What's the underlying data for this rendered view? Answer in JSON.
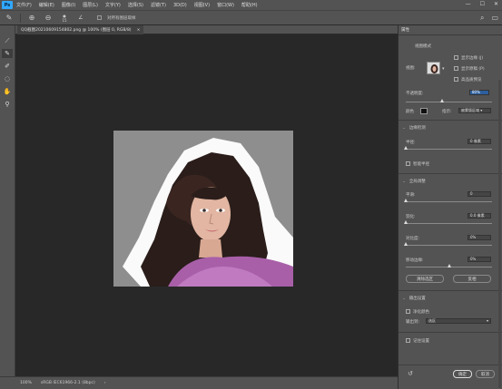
{
  "menubar": {
    "logo": "Ps",
    "items": [
      "文件(F)",
      "编辑(E)",
      "图像(I)",
      "图层(L)",
      "文字(Y)",
      "选择(S)",
      "滤镜(T)",
      "3D(D)",
      "视图(V)",
      "窗口(W)",
      "帮助(H)"
    ],
    "min": "—",
    "max": "☐",
    "close": "✕"
  },
  "options": {
    "brush_size": "15",
    "align_label": "对所有图层取样",
    "search_icon": "⌕",
    "share_icon": "▭"
  },
  "doc": {
    "tab_title": "QQ截图20210609154802.png @ 100% (图层 0, RGB/8)",
    "tab_close": "×"
  },
  "status": {
    "zoom": "100%",
    "info": "sRGB IEC61966-2.1 (8bpc)",
    "arrow": "›"
  },
  "panel": {
    "title": "属性",
    "view_mode": {
      "section": "视图模式",
      "view_label": "视图:",
      "show_edges": "显示边缘 (J)",
      "show_original": "显示原稿 (P)",
      "hq_preview": "高品质预览"
    },
    "opacity_label": "不透明度:",
    "opacity_value": "80%",
    "color_label": "颜色",
    "indicate_label": "指示:",
    "indicate_value": "被蒙版区域",
    "edge_detection": {
      "section": "边缘检测",
      "radius_label": "半径:",
      "radius_value": "0 像素",
      "smart_radius": "智能半径"
    },
    "global": {
      "section": "全局调整",
      "smooth_label": "平滑:",
      "smooth_value": "0",
      "feather_label": "羽化:",
      "feather_value": "0.0 像素",
      "contrast_label": "对比度:",
      "contrast_value": "0%",
      "shift_label": "移动边缘:",
      "shift_value": "0%",
      "clear_selection": "清除选区",
      "invert": "反相"
    },
    "output": {
      "section": "输出设置",
      "decontaminate": "净化颜色",
      "output_to_label": "输出到:",
      "output_to_value": "选区",
      "remember": "记住设置"
    },
    "ok": "确定",
    "cancel": "取消",
    "reset_icon": "↺"
  },
  "colors": {
    "accent": "#31a8ff",
    "canvas_bg": "#282828",
    "ui_bg": "#535353"
  }
}
